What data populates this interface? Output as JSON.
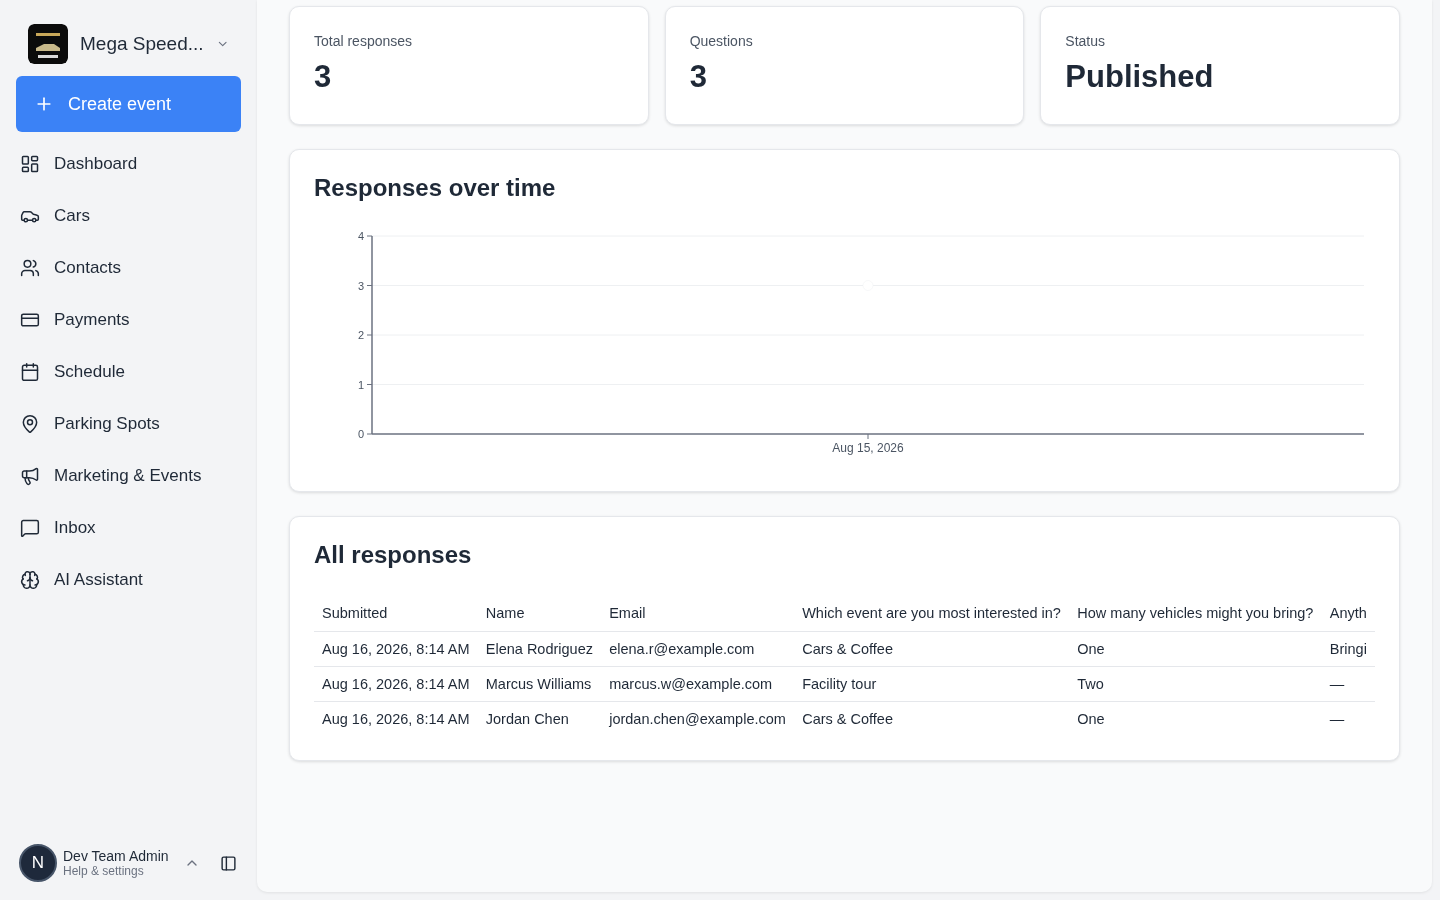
{
  "sidebar": {
    "org_name": "Mega Speed...",
    "create_button": "Create event",
    "items": [
      {
        "label": "Dashboard",
        "selected": false
      },
      {
        "label": "Cars",
        "selected": false
      },
      {
        "label": "Contacts",
        "selected": false
      },
      {
        "label": "Payments",
        "selected": false
      },
      {
        "label": "Schedule",
        "selected": false
      },
      {
        "label": "Parking Spots",
        "selected": false
      },
      {
        "label": "Marketing & Events",
        "selected": false
      },
      {
        "label": "Inbox",
        "selected": false
      },
      {
        "label": "AI Assistant",
        "selected": false
      }
    ],
    "user": {
      "initial": "N",
      "name": "Dev Team Admin",
      "subtitle": "Help & settings"
    }
  },
  "stats": [
    {
      "label": "Total responses",
      "value": "3"
    },
    {
      "label": "Questions",
      "value": "3"
    },
    {
      "label": "Status",
      "value": "Published"
    }
  ],
  "chart_card": {
    "title": "Responses over time",
    "chart_data": {
      "type": "line",
      "categories": [
        "Aug 15, 2026"
      ],
      "series": [
        {
          "color": "#ffffff",
          "marker": "circle",
          "values": [
            3
          ]
        }
      ],
      "ylim": [
        0,
        4
      ],
      "yticks": [
        0,
        1,
        2,
        3,
        4
      ],
      "grid": true
    }
  },
  "responses": {
    "title": "All responses",
    "columns": [
      "Submitted",
      "Name",
      "Email",
      "Which event are you most interested in?",
      "How many vehicles might you bring?",
      "Anyth"
    ],
    "rows": [
      [
        "Aug 16, 2026, 8:14 AM",
        "Elena Rodriguez",
        "elena.r@example.com",
        "Cars & Coffee",
        "One",
        "Bringi"
      ],
      [
        "Aug 16, 2026, 8:14 AM",
        "Marcus Williams",
        "marcus.w@example.com",
        "Facility tour",
        "Two",
        "—"
      ],
      [
        "Aug 16, 2026, 8:14 AM",
        "Jordan Chen",
        "jordan.chen@example.com",
        "Cars & Coffee",
        "One",
        "—"
      ]
    ]
  }
}
